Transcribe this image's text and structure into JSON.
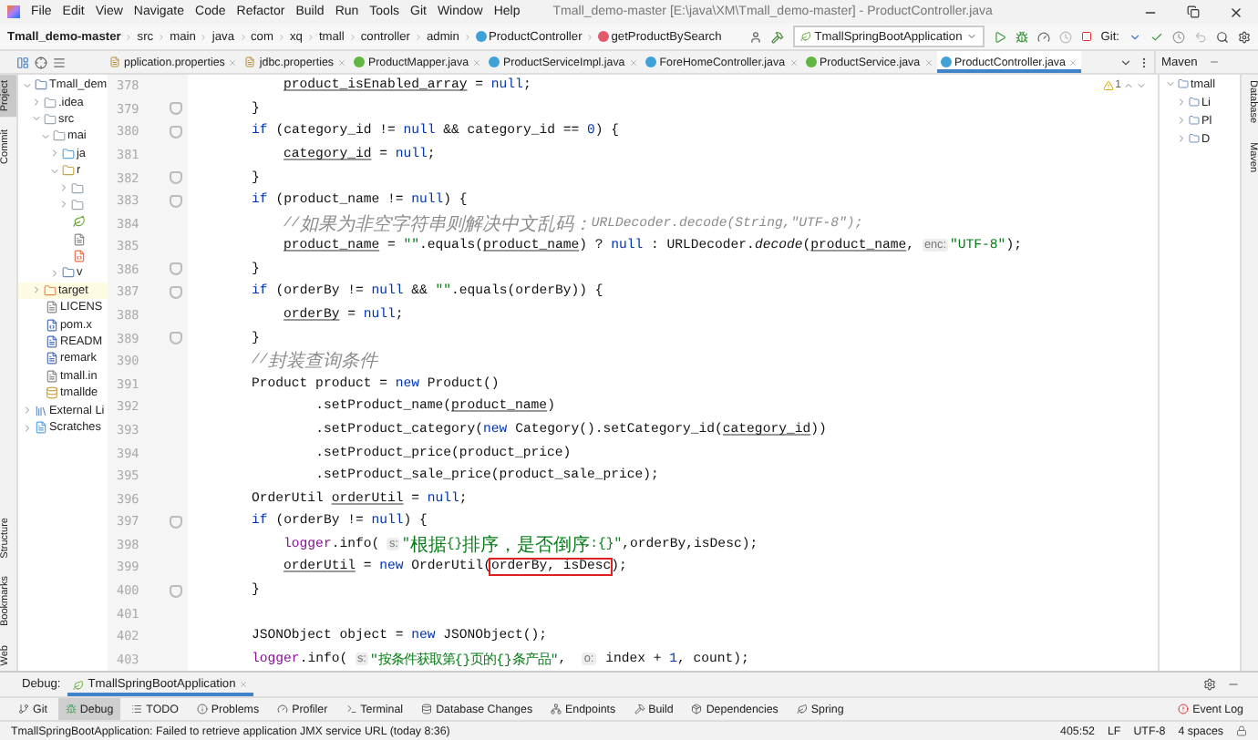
{
  "window": {
    "title": "Tmall_demo-master [E:\\java\\XM\\Tmall_demo-master] - ProductController.java"
  },
  "menu": [
    "File",
    "Edit",
    "View",
    "Navigate",
    "Code",
    "Refactor",
    "Build",
    "Run",
    "Tools",
    "Git",
    "Window",
    "Help"
  ],
  "breadcrumbs": [
    {
      "label": "Tmall_demo-master",
      "kind": "project"
    },
    {
      "label": "src",
      "kind": "dir"
    },
    {
      "label": "main",
      "kind": "dir"
    },
    {
      "label": "java",
      "kind": "dir"
    },
    {
      "label": "com",
      "kind": "dir"
    },
    {
      "label": "xq",
      "kind": "dir"
    },
    {
      "label": "tmall",
      "kind": "dir"
    },
    {
      "label": "controller",
      "kind": "dir"
    },
    {
      "label": "admin",
      "kind": "dir"
    },
    {
      "label": "ProductController",
      "kind": "class"
    },
    {
      "label": "getProductBySearch",
      "kind": "method"
    }
  ],
  "toolbar": {
    "run_config": "TmallSpringBootApplication",
    "git_label": "Git:"
  },
  "left_strip": [
    {
      "label": "Project",
      "selected": true
    },
    {
      "label": "Commit",
      "selected": false
    },
    {
      "label": "Structure",
      "selected": false
    },
    {
      "label": "Bookmarks",
      "selected": false
    },
    {
      "label": "Web",
      "selected": false
    }
  ],
  "right_strip": [
    "Database",
    "Maven"
  ],
  "project_tree": [
    {
      "label": "Tmall_dem",
      "kind": "module",
      "expanded": true,
      "selected": false,
      "children": [
        {
          "label": ".idea",
          "kind": "folder",
          "expanded": false,
          "selected": false
        },
        {
          "label": "src",
          "kind": "folder",
          "expanded": true,
          "selected": false,
          "children": [
            {
              "label": "mai",
              "kind": "folder",
              "expanded": true,
              "selected": false,
              "children": [
                {
                  "label": "ja",
                  "kind": "source",
                  "expanded": false,
                  "selected": false
                },
                {
                  "label": "r",
                  "kind": "resource",
                  "expanded": true,
                  "selected": false,
                  "children": [
                    {
                      "kind": "folder",
                      "expanded": false,
                      "selected": false
                    },
                    {
                      "kind": "folder",
                      "expanded": false,
                      "selected": false
                    },
                    {
                      "kind": "spring",
                      "selected": false
                    },
                    {
                      "kind": "file",
                      "selected": false
                    },
                    {
                      "kind": "xml",
                      "selected": false
                    }
                  ]
                },
                {
                  "label": "v",
                  "kind": "web",
                  "expanded": false,
                  "selected": false
                }
              ]
            }
          ]
        },
        {
          "label": "target",
          "kind": "excluded",
          "expanded": false,
          "selected": true
        },
        {
          "label": "LICENS",
          "kind": "file",
          "selected": false
        },
        {
          "label": "pom.x",
          "kind": "maven",
          "selected": false
        },
        {
          "label": "READM",
          "kind": "markdown",
          "selected": false
        },
        {
          "label": "remark",
          "kind": "markdown",
          "selected": false
        },
        {
          "label": "tmall.in",
          "kind": "file",
          "selected": false
        },
        {
          "label": "tmallde",
          "kind": "sql",
          "selected": false
        }
      ]
    },
    {
      "label": "External Li",
      "kind": "library",
      "expanded": false,
      "selected": false
    },
    {
      "label": "Scratches",
      "kind": "scratch",
      "expanded": false,
      "selected": false
    }
  ],
  "editor_tabs": [
    {
      "label": "pplication.properties",
      "kind": "properties",
      "selected": false
    },
    {
      "label": "jdbc.properties",
      "kind": "properties",
      "selected": false
    },
    {
      "label": "ProductMapper.java",
      "kind": "interface",
      "selected": false
    },
    {
      "label": "ProductServiceImpl.java",
      "kind": "class",
      "selected": false
    },
    {
      "label": "ForeHomeController.java",
      "kind": "class",
      "selected": false
    },
    {
      "label": "ProductService.java",
      "kind": "interface",
      "selected": false
    },
    {
      "label": "ProductController.java",
      "kind": "class",
      "selected": true
    }
  ],
  "editor": {
    "warnings": "1",
    "lines": [
      {
        "number": "378",
        "fold": false,
        "segments": [
          {
            "kind": "u",
            "text": "            product_isEnabled_array"
          },
          {
            "kind": "t",
            "text": " = "
          },
          {
            "kind": "k",
            "text": "null"
          },
          {
            "kind": "t",
            "text": ";"
          }
        ]
      },
      {
        "number": "379",
        "fold": true,
        "segments": [
          {
            "kind": "t",
            "text": "        }"
          }
        ]
      },
      {
        "number": "380",
        "fold": true,
        "segments": [
          {
            "kind": "k",
            "text": "        if"
          },
          {
            "kind": "t",
            "text": " (category_id != "
          },
          {
            "kind": "k",
            "text": "null"
          },
          {
            "kind": "t",
            "text": " && category_id == "
          },
          {
            "kind": "k",
            "text": "0"
          },
          {
            "kind": "t",
            "text": ") {"
          }
        ]
      },
      {
        "number": "381",
        "fold": false,
        "segments": [
          {
            "kind": "u",
            "text": "            category_id"
          },
          {
            "kind": "t",
            "text": " = "
          },
          {
            "kind": "k",
            "text": "null"
          },
          {
            "kind": "t",
            "text": ";"
          }
        ]
      },
      {
        "number": "382",
        "fold": true,
        "segments": [
          {
            "kind": "t",
            "text": "        }"
          }
        ]
      },
      {
        "number": "383",
        "fold": true,
        "segments": [
          {
            "kind": "k",
            "text": "        if"
          },
          {
            "kind": "t",
            "text": " (product_name != "
          },
          {
            "kind": "k",
            "text": "null"
          },
          {
            "kind": "t",
            "text": ") {"
          }
        ]
      },
      {
        "number": "384",
        "fold": false,
        "segments": [
          {
            "kind": "c",
            "text": "            //"
          },
          {
            "kind": "c-cjk",
            "text": "如果为非空字符串则解决中文乱码："
          },
          {
            "kind": "c",
            "text": "URLDecoder.decode(String,\"UTF-8\");"
          }
        ]
      },
      {
        "number": "385",
        "fold": false,
        "segments": [
          {
            "kind": "u",
            "text": "            product_name"
          },
          {
            "kind": "t",
            "text": " = "
          },
          {
            "kind": "s",
            "text": "\"\""
          },
          {
            "kind": "t",
            "text": ".equals("
          },
          {
            "kind": "u",
            "text": "product_name"
          },
          {
            "kind": "t",
            "text": ") ? "
          },
          {
            "kind": "k",
            "text": "null"
          },
          {
            "kind": "t",
            "text": " : URLDecoder."
          },
          {
            "kind": "m",
            "text": "decode"
          },
          {
            "kind": "t",
            "text": "("
          },
          {
            "kind": "u",
            "text": "product_name"
          },
          {
            "kind": "t",
            "text": ", "
          },
          {
            "kind": "h",
            "text": "enc:"
          },
          {
            "kind": "s",
            "text": "\"UTF-8\""
          },
          {
            "kind": "t",
            "text": ");"
          }
        ]
      },
      {
        "number": "386",
        "fold": true,
        "segments": [
          {
            "kind": "t",
            "text": "        }"
          }
        ]
      },
      {
        "number": "387",
        "fold": true,
        "segments": [
          {
            "kind": "k",
            "text": "        if"
          },
          {
            "kind": "t",
            "text": " (orderBy != "
          },
          {
            "kind": "k",
            "text": "null"
          },
          {
            "kind": "t",
            "text": " && "
          },
          {
            "kind": "s",
            "text": "\"\""
          },
          {
            "kind": "t",
            "text": ".equals(orderBy)) {"
          }
        ]
      },
      {
        "number": "388",
        "fold": false,
        "segments": [
          {
            "kind": "u",
            "text": "            orderBy"
          },
          {
            "kind": "t",
            "text": " = "
          },
          {
            "kind": "k",
            "text": "null"
          },
          {
            "kind": "t",
            "text": ";"
          }
        ]
      },
      {
        "number": "389",
        "fold": true,
        "segments": [
          {
            "kind": "t",
            "text": "        }"
          }
        ]
      },
      {
        "number": "390",
        "fold": false,
        "segments": [
          {
            "kind": "c",
            "text": "        //"
          },
          {
            "kind": "c-cjk",
            "text": "封装查询条件"
          }
        ]
      },
      {
        "number": "391",
        "fold": false,
        "segments": [
          {
            "kind": "t",
            "text": "        Product product = "
          },
          {
            "kind": "k",
            "text": "new"
          },
          {
            "kind": "t",
            "text": " Product()"
          }
        ]
      },
      {
        "number": "392",
        "fold": false,
        "segments": [
          {
            "kind": "t",
            "text": "                .setProduct_name("
          },
          {
            "kind": "u",
            "text": "product_name"
          },
          {
            "kind": "t",
            "text": ")"
          }
        ]
      },
      {
        "number": "393",
        "fold": false,
        "segments": [
          {
            "kind": "t",
            "text": "                .setProduct_category("
          },
          {
            "kind": "k",
            "text": "new"
          },
          {
            "kind": "t",
            "text": " Category().setCategory_id("
          },
          {
            "kind": "u",
            "text": "category_id"
          },
          {
            "kind": "t",
            "text": "))"
          }
        ]
      },
      {
        "number": "394",
        "fold": false,
        "segments": [
          {
            "kind": "t",
            "text": "                .setProduct_price(product_price)"
          }
        ]
      },
      {
        "number": "395",
        "fold": false,
        "segments": [
          {
            "kind": "t",
            "text": "                .setProduct_sale_price(product_sale_price);"
          }
        ]
      },
      {
        "number": "396",
        "fold": false,
        "segments": [
          {
            "kind": "t",
            "text": "        OrderUtil "
          },
          {
            "kind": "u",
            "text": "orderUtil"
          },
          {
            "kind": "t",
            "text": " = "
          },
          {
            "kind": "k",
            "text": "null"
          },
          {
            "kind": "t",
            "text": ";"
          }
        ]
      },
      {
        "number": "397",
        "fold": true,
        "segments": [
          {
            "kind": "k",
            "text": "        if"
          },
          {
            "kind": "t",
            "text": " (orderBy != "
          },
          {
            "kind": "k",
            "text": "null"
          },
          {
            "kind": "t",
            "text": ") {"
          }
        ]
      },
      {
        "number": "398",
        "fold": false,
        "segments": [
          {
            "kind": "f",
            "text": "            logger"
          },
          {
            "kind": "t",
            "text": ".info( "
          },
          {
            "kind": "h",
            "text": "s:"
          },
          {
            "kind": "s",
            "text": "\""
          },
          {
            "kind": "s-cjk",
            "text": "根据"
          },
          {
            "kind": "s",
            "text": "{}"
          },
          {
            "kind": "s-cjk",
            "text": "排序，是否倒序"
          },
          {
            "kind": "s",
            "text": ":{}\""
          },
          {
            "kind": "t",
            "text": ",orderBy,isDesc);"
          }
        ]
      },
      {
        "number": "399",
        "fold": false,
        "segments": [
          {
            "kind": "u",
            "text": "            orderUtil"
          },
          {
            "kind": "t",
            "text": " = "
          },
          {
            "kind": "k",
            "text": "new"
          },
          {
            "kind": "t",
            "text": " OrderUtil("
          },
          {
            "kind": "boxed",
            "text": "orderBy, isDesc"
          },
          {
            "kind": "t",
            "text": ");"
          }
        ]
      },
      {
        "number": "400",
        "fold": true,
        "segments": [
          {
            "kind": "t",
            "text": "        }"
          }
        ]
      },
      {
        "number": "401",
        "fold": false
      },
      {
        "number": "402",
        "fold": false,
        "segments": [
          {
            "kind": "t",
            "text": "        JSONObject object = "
          },
          {
            "kind": "k",
            "text": "new"
          },
          {
            "kind": "t",
            "text": " JSONObject();"
          }
        ]
      },
      {
        "number": "403",
        "fold": false,
        "segments": [
          {
            "kind": "f",
            "text": "        logger"
          },
          {
            "kind": "t",
            "text": ".info( "
          },
          {
            "kind": "h",
            "text": "s:"
          },
          {
            "kind": "s",
            "text": "\"按条件获取第{}页的{}条产品\""
          },
          {
            "kind": "t",
            "text": ",  "
          },
          {
            "kind": "h",
            "text": "o:"
          },
          {
            "kind": "t",
            "text": " index + "
          },
          {
            "kind": "k",
            "text": "1"
          },
          {
            "kind": "t",
            "text": ", count);"
          }
        ]
      }
    ]
  },
  "maven": {
    "title": "Maven",
    "items": [
      {
        "label": "tmall",
        "expanded": true
      },
      {
        "label": "Li",
        "expanded": false
      },
      {
        "label": "Pl",
        "expanded": false
      },
      {
        "label": "D",
        "expanded": false
      }
    ]
  },
  "debug_panel": {
    "label": "Debug:",
    "tab": "TmallSpringBootApplication"
  },
  "tool_windows": [
    {
      "label": "Git",
      "kind": "git",
      "selected": false
    },
    {
      "label": "Debug",
      "kind": "debug",
      "selected": true
    },
    {
      "label": "TODO",
      "kind": "list",
      "selected": false
    },
    {
      "label": "Problems",
      "kind": "info",
      "selected": false
    },
    {
      "label": "Profiler",
      "kind": "gauge",
      "selected": false
    },
    {
      "label": "Terminal",
      "kind": "terminal",
      "selected": false
    },
    {
      "label": "Database Changes",
      "kind": "database",
      "selected": false
    },
    {
      "label": "Endpoints",
      "kind": "nodes",
      "selected": false
    },
    {
      "label": "Build",
      "kind": "hammer",
      "selected": false
    },
    {
      "label": "Dependencies",
      "kind": "package",
      "selected": false
    },
    {
      "label": "Spring",
      "kind": "leaf",
      "selected": false
    }
  ],
  "event_log": {
    "label": "Event Log",
    "errors": true
  },
  "status_bar": {
    "message": "TmallSpringBootApplication: Failed to retrieve application JMX service URL (today 8:36)",
    "position": "405:52",
    "line_separator": "LF",
    "encoding": "UTF-8",
    "indent": "4 spaces"
  }
}
